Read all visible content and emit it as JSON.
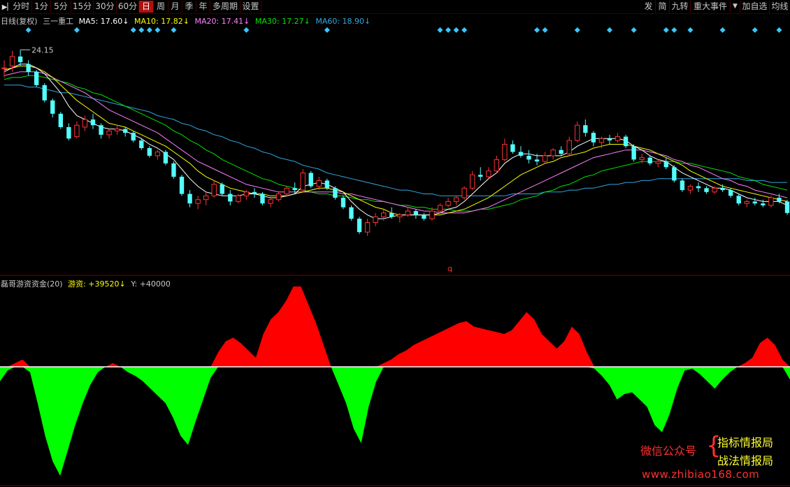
{
  "toolbar": {
    "left_buttons": [
      {
        "label": "分时",
        "icon": "back-arrow-icon"
      },
      {
        "label": "1分"
      },
      {
        "label": "5分"
      },
      {
        "label": "15分"
      },
      {
        "label": "30分"
      },
      {
        "label": "60分"
      },
      {
        "label": "日",
        "active": true
      },
      {
        "label": "周"
      },
      {
        "label": "月"
      },
      {
        "label": "季"
      },
      {
        "label": "年"
      },
      {
        "label": "多周期"
      },
      {
        "label": "设置"
      }
    ],
    "right_buttons": [
      {
        "label": "发"
      },
      {
        "label": "简"
      },
      {
        "label": "九转"
      },
      {
        "label": "重大事件"
      },
      {
        "label": "▼"
      },
      {
        "label": "加自选"
      },
      {
        "label": "均线"
      }
    ]
  },
  "main_legend": {
    "period_label": "日线(复权)",
    "stock_name": "三一重工",
    "ma5": "MA5: 17.60↓",
    "ma10": "MA10: 17.82↓",
    "ma20": "MA20: 17.41↓",
    "ma30": "MA30: 17.27↓",
    "ma60": "MA60: 18.90↓"
  },
  "high_marker": "24.15",
  "q_marker": "q",
  "indicator_legend": {
    "name": "磊哥游资资金(20)",
    "value": "游资: +39520↓",
    "y": "Y: +40000"
  },
  "colors": {
    "up": "#ff3232",
    "down": "#54ffff",
    "ma5": "#ffffff",
    "ma10": "#ffff00",
    "ma20": "#ff80ff",
    "ma30": "#00e600",
    "ma60": "#30a8e0",
    "positive_fill": "#ff0000",
    "negative_fill": "#00ff00",
    "diamond": "#3cc8ff"
  },
  "watermark": {
    "left": "微信公众号",
    "line1": "指标情报局",
    "line2": "战法情报局",
    "url": "www.zhibiao168.com"
  },
  "chart_data": [
    {
      "type": "candlestick",
      "title": "日线(复权) 三一重工",
      "y_max_label": "24.15",
      "ylim": [
        13.8,
        24.6
      ],
      "candles": [
        [
          23.2,
          23.6,
          22.7,
          23.2
        ],
        [
          23.3,
          24.1,
          23.0,
          23.8
        ],
        [
          23.8,
          24.15,
          23.3,
          23.5
        ],
        [
          23.4,
          23.6,
          22.8,
          23.0
        ],
        [
          23.0,
          23.1,
          22.2,
          22.3
        ],
        [
          22.3,
          22.4,
          21.4,
          21.5
        ],
        [
          21.5,
          21.6,
          20.6,
          20.8
        ],
        [
          20.8,
          20.9,
          20.0,
          20.1
        ],
        [
          20.1,
          20.3,
          19.4,
          19.5
        ],
        [
          19.6,
          20.4,
          19.5,
          20.2
        ],
        [
          20.1,
          20.7,
          19.9,
          20.5
        ],
        [
          20.5,
          20.8,
          20.0,
          20.2
        ],
        [
          20.2,
          20.3,
          19.5,
          19.7
        ],
        [
          19.7,
          20.0,
          19.5,
          19.9
        ],
        [
          19.9,
          20.2,
          19.7,
          20.0
        ],
        [
          20.0,
          20.1,
          19.6,
          19.8
        ],
        [
          19.8,
          19.9,
          19.3,
          19.4
        ],
        [
          19.4,
          19.5,
          18.9,
          19.0
        ],
        [
          19.0,
          19.1,
          18.5,
          18.6
        ],
        [
          18.6,
          18.9,
          18.4,
          18.8
        ],
        [
          18.8,
          18.9,
          18.1,
          18.2
        ],
        [
          18.2,
          18.3,
          17.4,
          17.5
        ],
        [
          17.5,
          17.6,
          16.5,
          16.6
        ],
        [
          16.6,
          16.8,
          15.9,
          16.1
        ],
        [
          16.1,
          16.5,
          15.8,
          16.3
        ],
        [
          16.3,
          16.7,
          16.0,
          16.5
        ],
        [
          16.5,
          17.3,
          16.4,
          17.1
        ],
        [
          17.1,
          17.2,
          16.5,
          16.6
        ],
        [
          16.6,
          16.8,
          16.0,
          16.2
        ],
        [
          16.2,
          16.6,
          16.1,
          16.5
        ],
        [
          16.5,
          16.8,
          16.3,
          16.7
        ],
        [
          16.7,
          16.9,
          16.4,
          16.6
        ],
        [
          16.6,
          16.7,
          16.0,
          16.1
        ],
        [
          16.1,
          16.4,
          15.9,
          16.3
        ],
        [
          16.3,
          16.7,
          16.2,
          16.6
        ],
        [
          16.6,
          17.0,
          16.5,
          16.9
        ],
        [
          16.9,
          17.2,
          16.6,
          16.8
        ],
        [
          16.8,
          17.9,
          16.7,
          17.7
        ],
        [
          17.7,
          17.8,
          16.9,
          17.0
        ],
        [
          17.0,
          17.5,
          16.8,
          17.3
        ],
        [
          17.3,
          17.4,
          16.8,
          16.9
        ],
        [
          16.9,
          17.0,
          16.3,
          16.4
        ],
        [
          16.4,
          16.5,
          15.8,
          15.9
        ],
        [
          15.9,
          16.0,
          15.2,
          15.3
        ],
        [
          15.3,
          15.4,
          14.5,
          14.6
        ],
        [
          14.6,
          15.3,
          14.4,
          15.1
        ],
        [
          15.1,
          15.6,
          14.9,
          15.4
        ],
        [
          15.4,
          15.8,
          15.2,
          15.6
        ],
        [
          15.6,
          15.9,
          15.3,
          15.4
        ],
        [
          15.4,
          15.6,
          15.1,
          15.5
        ],
        [
          15.5,
          15.9,
          15.4,
          15.7
        ],
        [
          15.7,
          15.8,
          15.3,
          15.5
        ],
        [
          15.5,
          15.6,
          15.2,
          15.3
        ],
        [
          15.3,
          15.9,
          15.2,
          15.7
        ],
        [
          15.7,
          16.1,
          15.6,
          16.0
        ],
        [
          16.0,
          16.4,
          15.9,
          16.2
        ],
        [
          16.2,
          16.5,
          16.0,
          16.4
        ],
        [
          16.4,
          17.0,
          16.3,
          16.9
        ],
        [
          16.9,
          17.8,
          16.8,
          17.6
        ],
        [
          17.6,
          18.0,
          17.3,
          17.5
        ],
        [
          17.5,
          18.0,
          17.4,
          17.8
        ],
        [
          17.8,
          18.6,
          17.7,
          18.4
        ],
        [
          18.4,
          19.5,
          18.3,
          19.2
        ],
        [
          19.2,
          19.4,
          18.7,
          18.8
        ],
        [
          18.8,
          19.1,
          18.5,
          18.6
        ],
        [
          18.6,
          18.9,
          18.2,
          18.4
        ],
        [
          18.4,
          18.7,
          18.1,
          18.3
        ],
        [
          18.3,
          18.8,
          18.2,
          18.6
        ],
        [
          18.6,
          19.0,
          18.4,
          18.9
        ],
        [
          18.9,
          19.1,
          18.6,
          18.7
        ],
        [
          18.7,
          19.6,
          18.6,
          19.4
        ],
        [
          19.4,
          20.4,
          19.3,
          20.2
        ],
        [
          20.2,
          20.5,
          19.6,
          19.8
        ],
        [
          19.8,
          19.9,
          19.1,
          19.3
        ],
        [
          19.3,
          19.6,
          19.0,
          19.5
        ],
        [
          19.5,
          19.7,
          19.2,
          19.4
        ],
        [
          19.4,
          19.8,
          19.3,
          19.6
        ],
        [
          19.6,
          19.7,
          19.0,
          19.1
        ],
        [
          19.1,
          19.2,
          18.3,
          18.4
        ],
        [
          18.4,
          18.7,
          18.2,
          18.5
        ],
        [
          18.5,
          18.6,
          18.1,
          18.2
        ],
        [
          18.2,
          18.4,
          18.0,
          18.3
        ],
        [
          18.3,
          18.5,
          17.9,
          18.0
        ],
        [
          18.0,
          18.1,
          17.2,
          17.3
        ],
        [
          17.3,
          17.4,
          16.7,
          16.8
        ],
        [
          16.8,
          17.1,
          16.6,
          17.0
        ],
        [
          17.0,
          17.2,
          16.7,
          16.9
        ],
        [
          16.9,
          17.0,
          16.6,
          16.7
        ],
        [
          16.7,
          17.0,
          16.6,
          16.9
        ],
        [
          16.9,
          17.1,
          16.7,
          16.8
        ],
        [
          16.8,
          16.9,
          16.4,
          16.5
        ],
        [
          16.5,
          16.6,
          16.0,
          16.1
        ],
        [
          16.1,
          16.3,
          15.9,
          16.2
        ],
        [
          16.2,
          16.4,
          16.0,
          16.1
        ],
        [
          16.1,
          16.3,
          15.9,
          16.0
        ],
        [
          16.0,
          16.5,
          15.9,
          16.4
        ],
        [
          16.4,
          16.6,
          16.1,
          16.2
        ],
        [
          16.2,
          16.3,
          15.5,
          15.6
        ]
      ],
      "ma5": [
        23.0,
        23.2,
        23.4,
        23.4,
        23.2,
        22.9,
        22.4,
        21.9,
        21.2,
        20.7,
        20.5,
        20.3,
        20.1,
        20.0,
        20.0,
        19.9,
        19.7,
        19.5,
        19.2,
        19.0,
        18.7,
        18.4,
        17.9,
        17.4,
        17.0,
        16.7,
        16.6,
        16.5,
        16.5,
        16.5,
        16.6,
        16.6,
        16.5,
        16.4,
        16.4,
        16.5,
        16.6,
        17.0,
        17.1,
        17.2,
        17.1,
        16.9,
        16.7,
        16.2,
        15.8,
        15.5,
        15.3,
        15.3,
        15.4,
        15.5,
        15.5,
        15.5,
        15.5,
        15.5,
        15.6,
        15.8,
        15.9,
        16.2,
        16.6,
        17.0,
        17.4,
        17.7,
        18.2,
        18.5,
        18.7,
        18.7,
        18.6,
        18.6,
        18.6,
        18.6,
        18.8,
        19.1,
        19.3,
        19.5,
        19.5,
        19.5,
        19.5,
        19.4,
        19.1,
        18.9,
        18.6,
        18.4,
        18.3,
        18.0,
        17.7,
        17.5,
        17.3,
        17.1,
        16.9,
        16.9,
        16.8,
        16.6,
        16.4,
        16.3,
        16.2,
        16.2,
        16.2,
        16.0
      ],
      "ma10": [
        23.1,
        23.2,
        23.3,
        23.3,
        23.2,
        23.0,
        22.7,
        22.3,
        21.9,
        21.5,
        21.2,
        20.9,
        20.6,
        20.3,
        20.2,
        20.1,
        19.9,
        19.7,
        19.5,
        19.3,
        19.1,
        18.8,
        18.5,
        18.2,
        17.8,
        17.5,
        17.3,
        17.1,
        16.9,
        16.8,
        16.7,
        16.6,
        16.6,
        16.5,
        16.5,
        16.5,
        16.6,
        16.7,
        16.8,
        16.9,
        16.9,
        16.8,
        16.7,
        16.5,
        16.3,
        16.1,
        15.9,
        15.8,
        15.6,
        15.5,
        15.5,
        15.5,
        15.5,
        15.5,
        15.5,
        15.6,
        15.7,
        15.8,
        16.0,
        16.2,
        16.4,
        16.7,
        17.0,
        17.3,
        17.6,
        17.8,
        18.0,
        18.2,
        18.3,
        18.5,
        18.6,
        18.7,
        18.8,
        19.0,
        19.1,
        19.2,
        19.2,
        19.2,
        19.1,
        19.0,
        18.9,
        18.7,
        18.5,
        18.3,
        18.1,
        17.8,
        17.6,
        17.4,
        17.2,
        17.0,
        16.9,
        16.8,
        16.7,
        16.6,
        16.5,
        16.4,
        16.3,
        16.2
      ],
      "ma20": [
        22.8,
        22.9,
        23.0,
        23.0,
        23.0,
        22.9,
        22.7,
        22.5,
        22.3,
        22.1,
        21.9,
        21.6,
        21.3,
        21.0,
        20.8,
        20.6,
        20.4,
        20.2,
        20.0,
        19.8,
        19.5,
        19.2,
        18.9,
        18.6,
        18.3,
        18.1,
        17.9,
        17.7,
        17.5,
        17.3,
        17.1,
        17.0,
        16.9,
        16.8,
        16.7,
        16.7,
        16.7,
        16.7,
        16.7,
        16.7,
        16.7,
        16.7,
        16.6,
        16.6,
        16.5,
        16.4,
        16.3,
        16.2,
        16.1,
        16.0,
        15.9,
        15.8,
        15.7,
        15.7,
        15.6,
        15.6,
        15.6,
        15.6,
        15.7,
        15.8,
        15.9,
        16.1,
        16.3,
        16.5,
        16.7,
        16.9,
        17.1,
        17.3,
        17.5,
        17.7,
        17.9,
        18.1,
        18.3,
        18.5,
        18.6,
        18.7,
        18.8,
        18.9,
        18.9,
        18.9,
        18.8,
        18.7,
        18.6,
        18.4,
        18.3,
        18.1,
        18.0,
        17.8,
        17.6,
        17.4,
        17.3,
        17.1,
        17.0,
        16.8,
        16.7,
        16.6,
        16.5,
        16.4
      ],
      "ma30": [
        22.6,
        22.7,
        22.7,
        22.8,
        22.8,
        22.7,
        22.6,
        22.5,
        22.4,
        22.2,
        22.1,
        21.9,
        21.8,
        21.6,
        21.4,
        21.2,
        21.0,
        20.8,
        20.6,
        20.4,
        20.2,
        19.9,
        19.7,
        19.4,
        19.2,
        18.9,
        18.7,
        18.4,
        18.2,
        18.0,
        17.8,
        17.6,
        17.4,
        17.3,
        17.1,
        17.0,
        16.9,
        16.8,
        16.7,
        16.6,
        16.6,
        16.5,
        16.5,
        16.4,
        16.3,
        16.3,
        16.2,
        16.2,
        16.1,
        16.0,
        16.0,
        15.9,
        15.9,
        15.8,
        15.8,
        15.8,
        15.7,
        15.7,
        15.7,
        15.8,
        15.8,
        15.9,
        16.0,
        16.1,
        16.3,
        16.4,
        16.5,
        16.7,
        16.8,
        17.0,
        17.1,
        17.3,
        17.5,
        17.6,
        17.8,
        17.9,
        18.0,
        18.1,
        18.2,
        18.3,
        18.3,
        18.3,
        18.3,
        18.3,
        18.2,
        18.2,
        18.1,
        18.0,
        17.9,
        17.8,
        17.7,
        17.5,
        17.4,
        17.3,
        17.1,
        17.0,
        16.9,
        16.8
      ],
      "ma60": [
        22.3,
        22.3,
        22.3,
        22.2,
        22.2,
        22.1,
        22.0,
        21.9,
        21.9,
        21.8,
        21.7,
        21.6,
        21.5,
        21.4,
        21.3,
        21.2,
        21.1,
        21.0,
        20.9,
        20.7,
        20.6,
        20.5,
        20.3,
        20.2,
        20.0,
        19.9,
        19.7,
        19.6,
        19.4,
        19.3,
        19.1,
        19.0,
        18.8,
        18.7,
        18.5,
        18.4,
        18.3,
        18.1,
        18.0,
        17.9,
        17.7,
        17.6,
        17.5,
        17.4,
        17.3,
        17.2,
        17.1,
        17.0,
        16.9,
        16.8,
        16.8,
        16.7,
        16.6,
        16.6,
        16.5,
        16.5,
        16.5,
        16.5,
        16.5,
        16.5,
        16.5,
        16.5,
        16.5,
        16.6,
        16.6,
        16.6,
        16.6,
        16.7,
        16.7,
        16.7,
        16.8,
        16.8,
        16.9,
        16.9,
        17.0,
        17.1,
        17.1,
        17.2,
        17.2,
        17.3,
        17.3,
        17.4,
        17.4,
        17.4,
        17.4,
        17.4,
        17.4,
        17.4,
        17.4,
        17.4,
        17.4,
        17.4,
        17.3,
        17.3,
        17.3,
        17.2,
        17.2,
        17.2
      ],
      "signal_bars": [
        3,
        9,
        16,
        17,
        18,
        19,
        21,
        30,
        40,
        54,
        55,
        56,
        57,
        66,
        67,
        71,
        75,
        78,
        82,
        83,
        85,
        89,
        93,
        96,
        102
      ]
    },
    {
      "type": "area",
      "title": "磊哥游资资金(20)",
      "ylim": [
        -65000,
        44000
      ],
      "zero_line": 0,
      "values": [
        -8000,
        -2000,
        2000,
        4000,
        -3000,
        -20000,
        -38000,
        -52000,
        -60000,
        -46000,
        -32000,
        -20000,
        -10000,
        -3000,
        0,
        2000,
        0,
        -3000,
        -5000,
        -8000,
        -12000,
        -16000,
        -20000,
        -28000,
        -38000,
        -43000,
        -30000,
        -18000,
        -6000,
        8000,
        14000,
        16000,
        13000,
        9000,
        5000,
        18000,
        26000,
        30000,
        36000,
        44000,
        44000,
        34000,
        24000,
        12000,
        0,
        -10000,
        -20000,
        -34000,
        -42000,
        -22000,
        -8000,
        2000,
        4000,
        7000,
        9000,
        12000,
        14000,
        16000,
        18000,
        20000,
        22000,
        24000,
        25000,
        22000,
        21000,
        20000,
        19000,
        18000,
        20000,
        25000,
        30000,
        26000,
        18000,
        14000,
        10000,
        14000,
        22000,
        18000,
        8000,
        -1000,
        -5000,
        -10000,
        -18000,
        -15000,
        -14000,
        -18000,
        -22000,
        -32000,
        -36000,
        -26000,
        -12000,
        -2000,
        -1000,
        -4000,
        -8000,
        -12000,
        -7000,
        -3000,
        0,
        2000,
        5000,
        13000,
        16000,
        12000,
        4000,
        -7000
      ]
    }
  ]
}
